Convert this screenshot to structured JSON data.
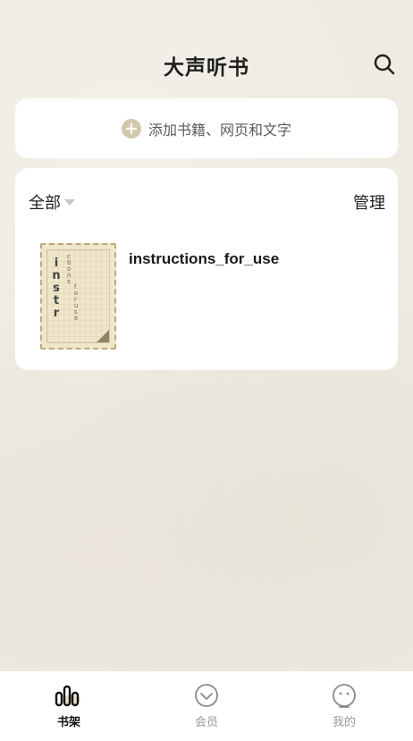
{
  "header": {
    "title": "大声听书"
  },
  "add_card": {
    "label": "添加书籍、网页和文字"
  },
  "shelf": {
    "filter_label": "全部",
    "manage_label": "管理",
    "books": [
      {
        "title": "instructions_for_use",
        "cover_big": "instr",
        "cover_small": "ctions",
        "cover_small2": "foruse"
      }
    ]
  },
  "tabbar": {
    "tabs": [
      {
        "label": "书架",
        "icon": "bookshelf-icon",
        "active": true
      },
      {
        "label": "会员",
        "icon": "heart-icon",
        "active": false
      },
      {
        "label": "我的",
        "icon": "smiley-icon",
        "active": false
      }
    ]
  },
  "colors": {
    "background": "#efebe2",
    "card": "#ffffff",
    "accent": "#d2c7ad",
    "cover": "#efe6cc"
  }
}
